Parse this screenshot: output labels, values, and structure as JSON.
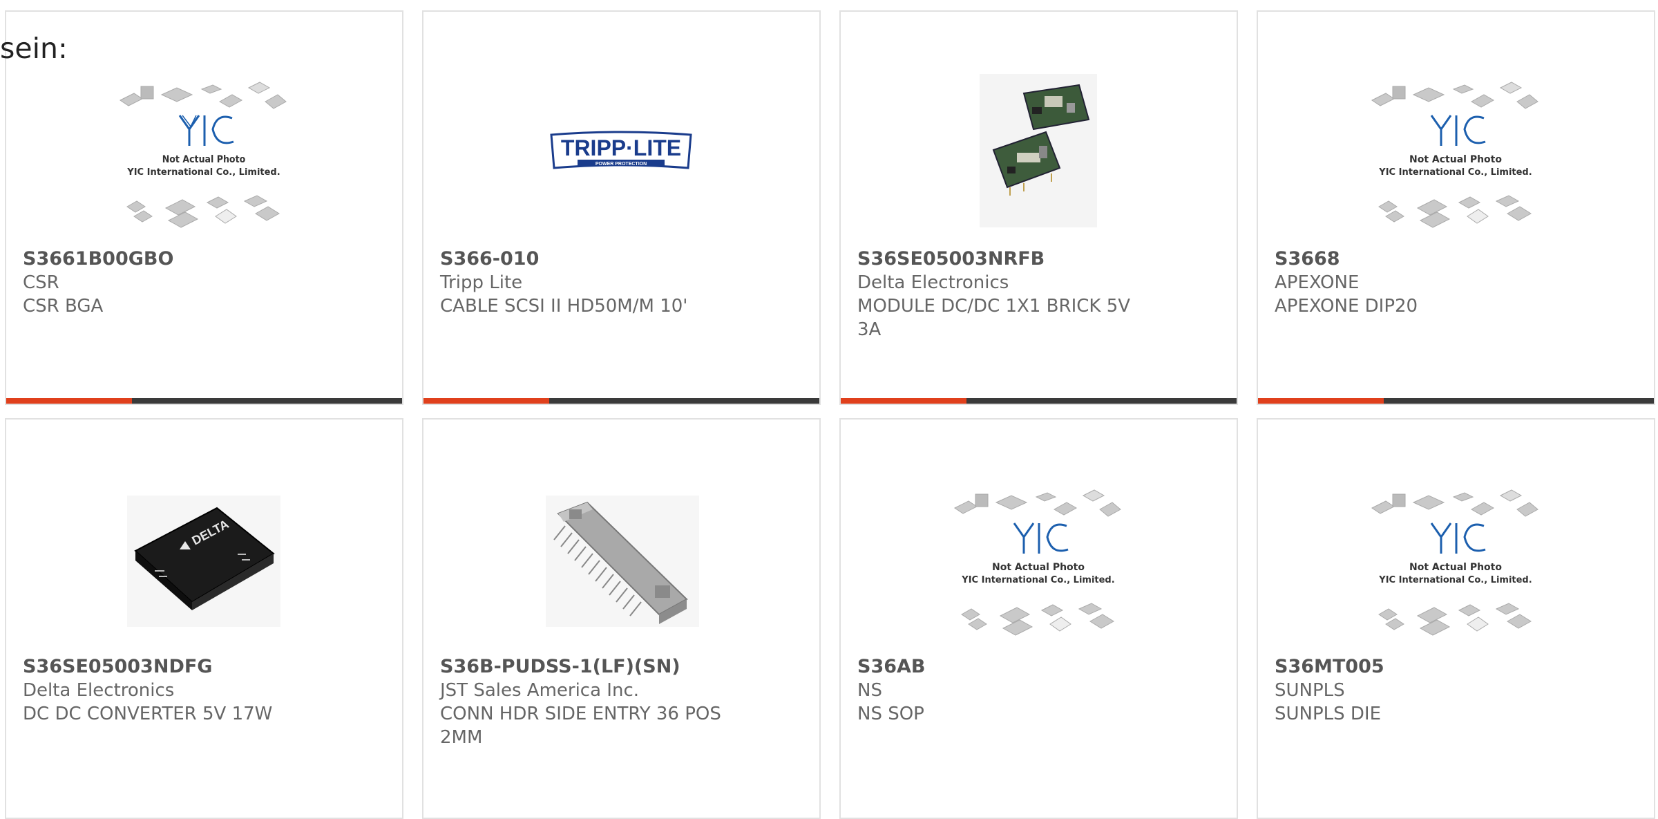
{
  "header": {
    "label": "sein:"
  },
  "products": [
    {
      "part_number": "S3661B00GBO",
      "manufacturer": "CSR",
      "description": "CSR BGA",
      "image_icon": "not-actual-photo-icon",
      "placeholder_line1": "Not Actual Photo",
      "placeholder_line2": "YIC International Co., Limited."
    },
    {
      "part_number": "S366-010",
      "manufacturer": "Tripp Lite",
      "description": "CABLE SCSI II HD50M/M 10'",
      "image_icon": "tripp-lite-logo-icon",
      "logo_text": "TRIPP·LITE",
      "logo_subtext": "POWER PROTECTION"
    },
    {
      "part_number": "S36SE05003NRFB",
      "manufacturer": "Delta Electronics",
      "description": "MODULE DC/DC 1X1 BRICK 5V 3A",
      "image_icon": "dc-dc-module-icon"
    },
    {
      "part_number": "S3668",
      "manufacturer": "APEXONE",
      "description": "APEXONE DIP20",
      "image_icon": "not-actual-photo-icon",
      "placeholder_line1": "Not Actual Photo",
      "placeholder_line2": "YIC International Co., Limited."
    },
    {
      "part_number": "S36SE05003NDFG",
      "manufacturer": "Delta Electronics",
      "description": "DC DC CONVERTER 5V 17W",
      "image_icon": "delta-converter-icon",
      "logo_text": "DELTA"
    },
    {
      "part_number": "S36B-PUDSS-1(LF)(SN)",
      "manufacturer": "JST Sales America Inc.",
      "description": "CONN HDR SIDE ENTRY 36 POS 2MM",
      "image_icon": "connector-header-icon"
    },
    {
      "part_number": "S36AB",
      "manufacturer": "NS",
      "description": "NS SOP",
      "image_icon": "not-actual-photo-icon",
      "placeholder_line1": "Not Actual Photo",
      "placeholder_line2": "YIC International Co., Limited."
    },
    {
      "part_number": "S36MT005",
      "manufacturer": "SUNPLS",
      "description": "SUNPLS DIE",
      "image_icon": "not-actual-photo-icon",
      "placeholder_line1": "Not Actual Photo",
      "placeholder_line2": "YIC International Co., Limited."
    }
  ],
  "colors": {
    "accent": "#e0401c",
    "bar": "#3a3a3a",
    "border": "#e1e1e1",
    "yic_blue": "#1c5fae"
  }
}
